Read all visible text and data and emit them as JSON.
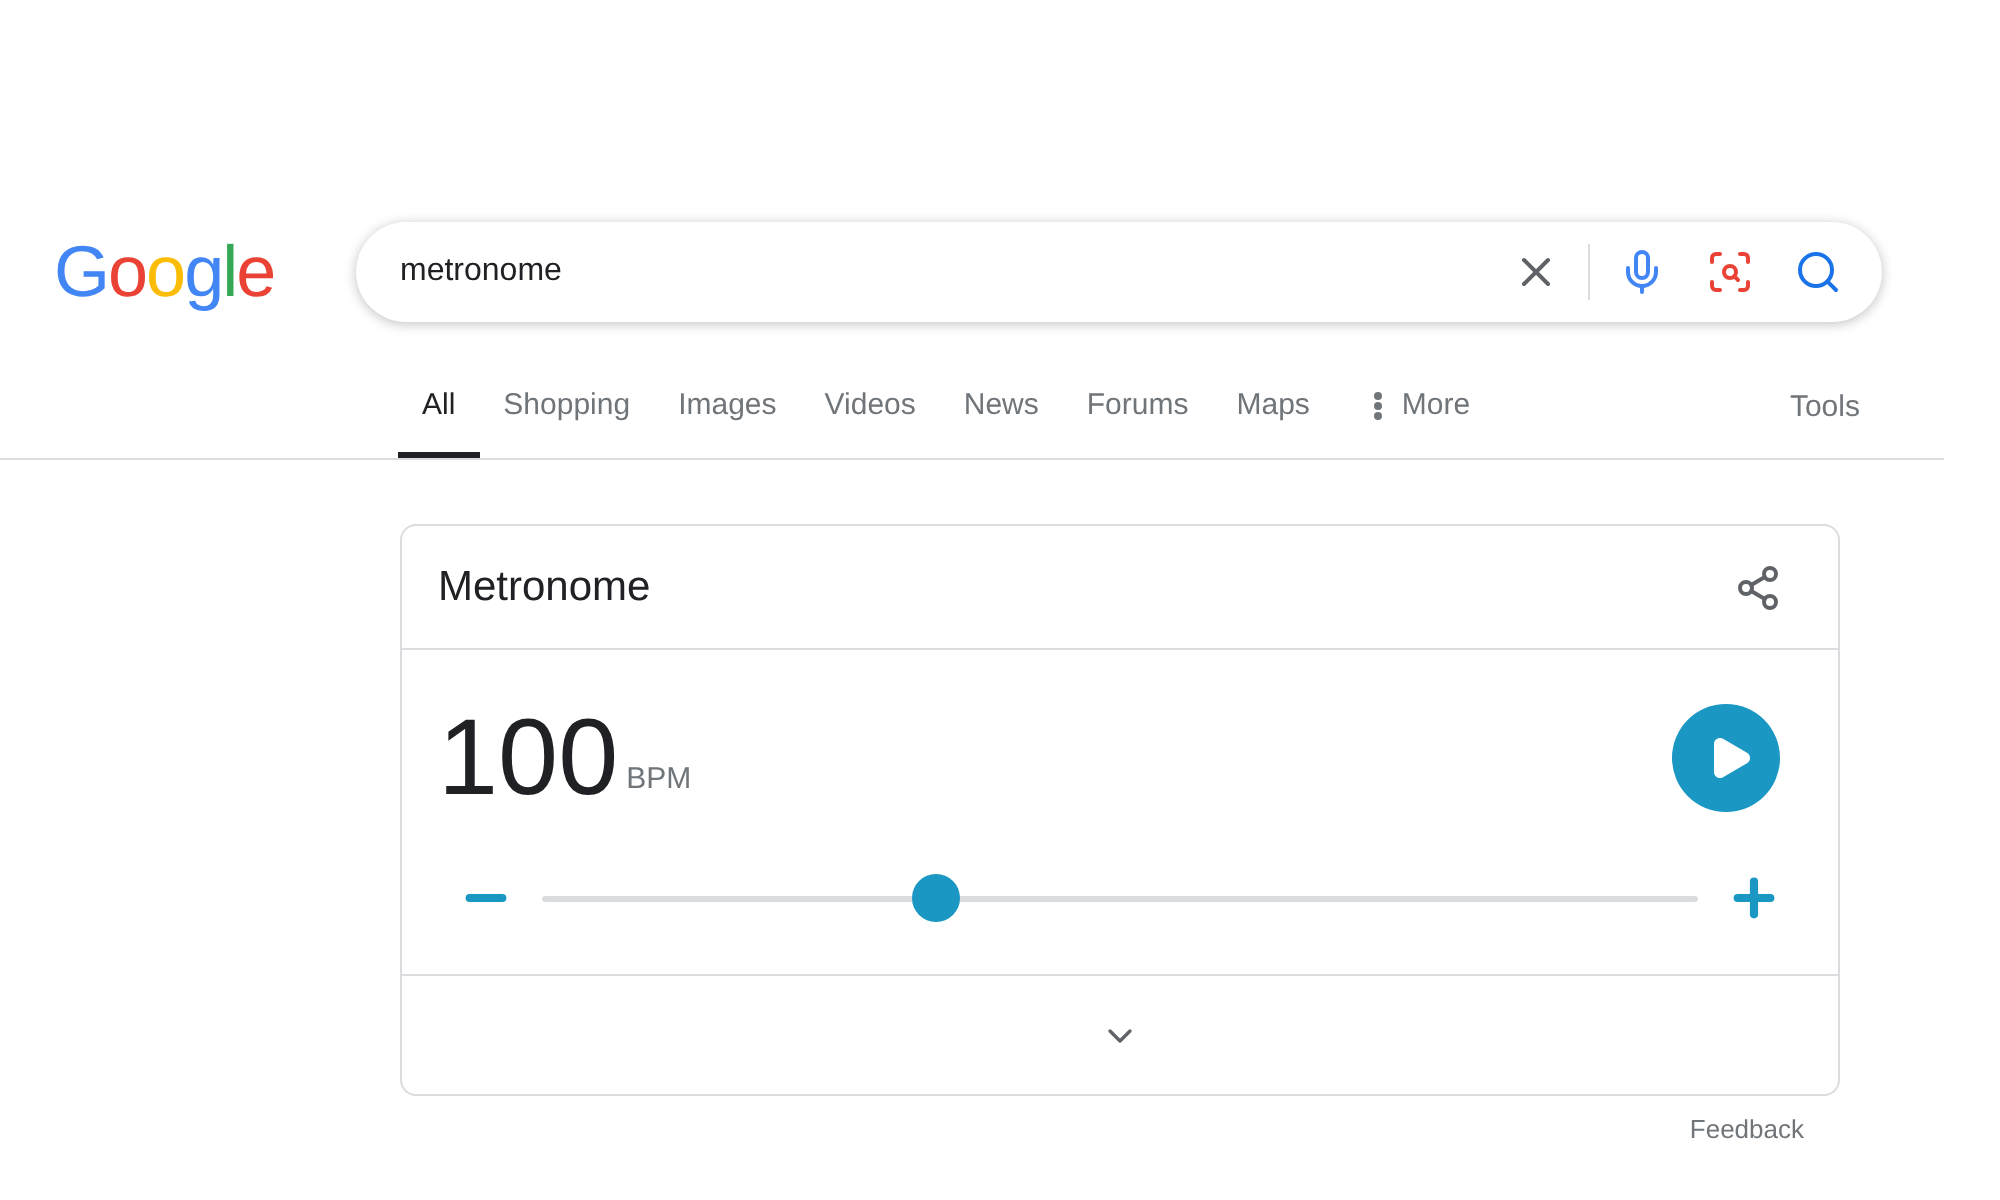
{
  "logo": {
    "text": "Google"
  },
  "search": {
    "value": "metronome"
  },
  "tabs": [
    {
      "label": "All",
      "selected": true,
      "kind": "plain"
    },
    {
      "label": "Shopping",
      "selected": false,
      "kind": "plain"
    },
    {
      "label": "Images",
      "selected": false,
      "kind": "plain"
    },
    {
      "label": "Videos",
      "selected": false,
      "kind": "plain"
    },
    {
      "label": "News",
      "selected": false,
      "kind": "plain"
    },
    {
      "label": "Forums",
      "selected": false,
      "kind": "plain"
    },
    {
      "label": "Maps",
      "selected": false,
      "kind": "plain"
    },
    {
      "label": "More",
      "selected": false,
      "kind": "more"
    }
  ],
  "tools": "Tools",
  "metronome": {
    "title": "Metronome",
    "tempo": "100",
    "unit": "BPM",
    "slider": {
      "level": 0.34
    }
  },
  "feedback": "Feedback"
}
